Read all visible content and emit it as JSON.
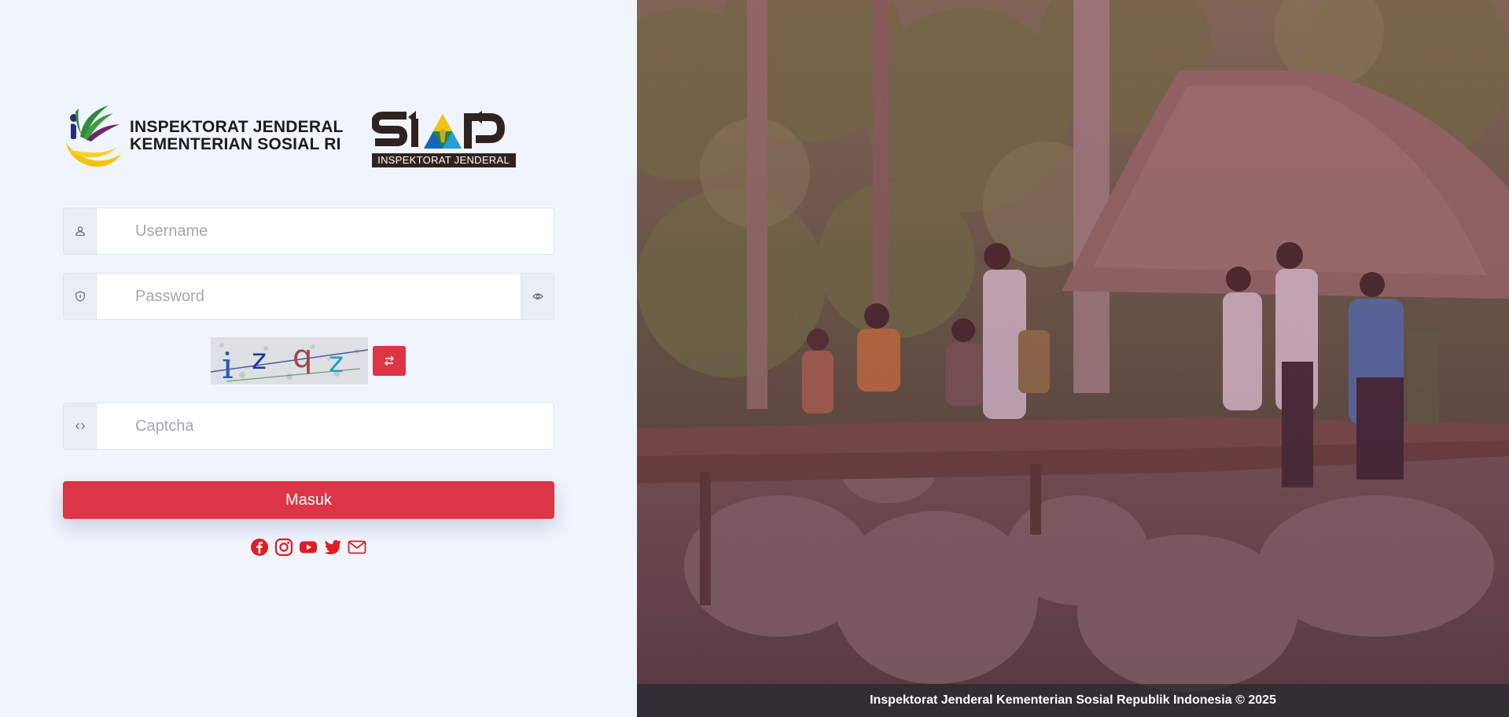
{
  "brand": {
    "org_line1": "INSPEKTORAT JENDERAL",
    "org_line2": "KEMENTERIAN SOSIAL RI",
    "app_logo_text": "SIAP",
    "app_logo_sub": "INSPEKTORAT JENDERAL"
  },
  "form": {
    "username": {
      "placeholder": "Username",
      "value": "",
      "icon": "user-icon"
    },
    "password": {
      "placeholder": "Password",
      "value": "",
      "icon": "shield-icon",
      "toggle_icon": "eye-icon"
    },
    "captcha_image_text": "izqz",
    "captcha_refresh_icon": "swap-arrows-icon",
    "captcha": {
      "placeholder": "Captcha",
      "value": "",
      "icon": "code-icon"
    },
    "submit_label": "Masuk"
  },
  "social": [
    "facebook-icon",
    "instagram-icon",
    "youtube-icon",
    "twitter-icon",
    "envelope-icon"
  ],
  "footer": {
    "text": "Inspektorat Jenderal Kementerian Sosial Republik Indonesia © 2025"
  },
  "colors": {
    "accent": "#dc3545",
    "background": "#f0f4fd",
    "addon": "#e9eef5"
  }
}
